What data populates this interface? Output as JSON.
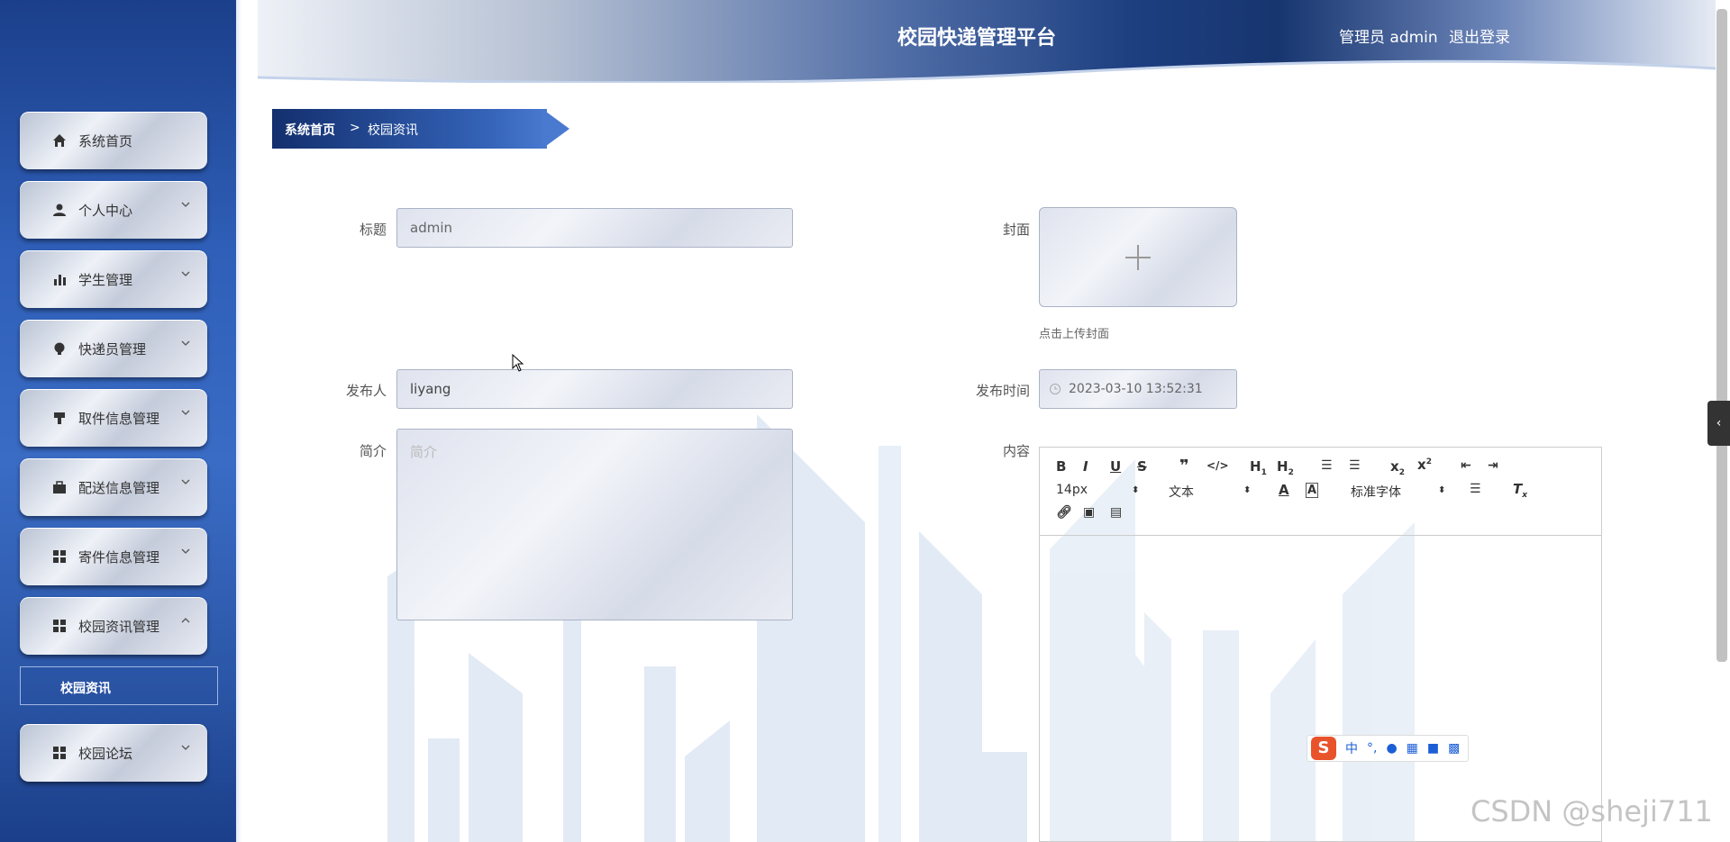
{
  "header": {
    "title": "校园快递管理平台",
    "user": "管理员 admin",
    "logout": "退出登录"
  },
  "sidebar": {
    "items": [
      {
        "label": "系统首页",
        "icon": "home-icon"
      },
      {
        "label": "个人中心",
        "icon": "user-icon"
      },
      {
        "label": "学生管理",
        "icon": "bar-chart-icon"
      },
      {
        "label": "快递员管理",
        "icon": "bulb-icon"
      },
      {
        "label": "取件信息管理",
        "icon": "stamp-icon"
      },
      {
        "label": "配送信息管理",
        "icon": "briefcase-icon"
      },
      {
        "label": "寄件信息管理",
        "icon": "grid-icon"
      },
      {
        "label": "校园资讯管理",
        "icon": "grid-icon"
      },
      {
        "label": "校园论坛",
        "icon": "grid-icon"
      }
    ],
    "sub_item": "校园资讯"
  },
  "breadcrumb": {
    "home": "系统首页",
    "separator": ">",
    "current": "校园资讯"
  },
  "form": {
    "title_label": "标题",
    "title_value": "admin",
    "cover_label": "封面",
    "cover_hint": "点击上传封面",
    "publisher_label": "发布人",
    "publisher_value": "liyang",
    "publish_time_label": "发布时间",
    "publish_time_value": "2023-03-10 13:52:31",
    "summary_label": "简介",
    "summary_placeholder": "简介",
    "content_label": "内容"
  },
  "editor": {
    "font_size": "14px",
    "paragraph": "文本",
    "font_family": "标准字体"
  },
  "ime": {
    "chars": [
      "中",
      "°,"
    ]
  },
  "watermark": "CSDN @sheji711"
}
